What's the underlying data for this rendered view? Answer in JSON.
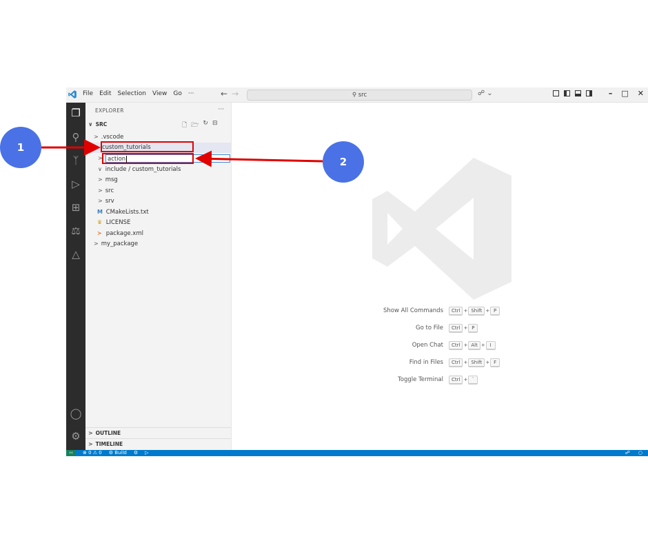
{
  "titlebar": {
    "menu": [
      "File",
      "Edit",
      "Selection",
      "View",
      "Go",
      "···"
    ],
    "search": "src",
    "nav_back": "←",
    "nav_forward": "→"
  },
  "activity_icons": [
    "explorer-icon",
    "search-icon",
    "source-control-icon",
    "run-debug-icon",
    "extensions-icon",
    "testing-icon",
    "ros-icon",
    "account-icon",
    "settings-gear-icon"
  ],
  "sidebar": {
    "title": "EXPLORER",
    "root": "SRC",
    "tree": [
      {
        "label": ".vscode",
        "chevron": ">"
      },
      {
        "label": "custom_tutorials",
        "chevron": "",
        "rename_box": true
      },
      {
        "label": "action",
        "chevron": ">",
        "editing": true
      },
      {
        "label": "include / custom_tutorials",
        "chevron": "∨"
      },
      {
        "label": "msg",
        "chevron": ">"
      },
      {
        "label": "src",
        "chevron": ">"
      },
      {
        "label": "srv",
        "chevron": ">"
      },
      {
        "label": "CMakeLists.txt",
        "icon": "M"
      },
      {
        "label": "LICENSE",
        "icon": "license-icon"
      },
      {
        "label": "package.xml",
        "icon": "rss-icon"
      },
      {
        "label": "my_package",
        "chevron": ">"
      }
    ],
    "outline": "OUTLINE",
    "timeline": "TIMELINE"
  },
  "shortcuts": [
    {
      "label": "Show All Commands",
      "keys": [
        "Ctrl",
        "Shift",
        "P"
      ]
    },
    {
      "label": "Go to File",
      "keys": [
        "Ctrl",
        "P"
      ]
    },
    {
      "label": "Open Chat",
      "keys": [
        "Ctrl",
        "Alt",
        "I"
      ]
    },
    {
      "label": "Find in Files",
      "keys": [
        "Ctrl",
        "Shift",
        "F"
      ]
    },
    {
      "label": "Toggle Terminal",
      "keys": [
        "Ctrl",
        "`"
      ]
    }
  ],
  "statusbar": {
    "problems": "⊗ 0 ⚠ 0",
    "build": "⚙ Build"
  },
  "annotations": {
    "badge1": "1",
    "badge2": "2"
  },
  "colors": {
    "badge": "#4a72e6",
    "annotation_red": "#e00000",
    "statusbar": "#007acc",
    "activity_bar": "#2c2c2c"
  }
}
